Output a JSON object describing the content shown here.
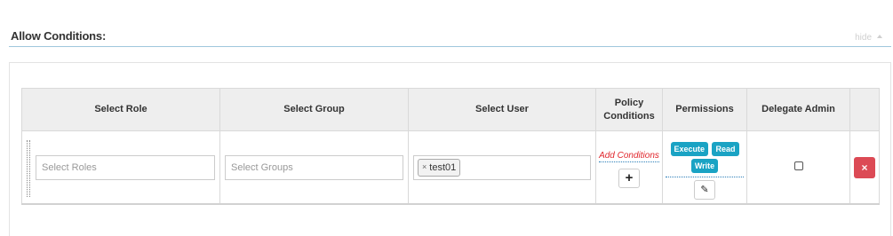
{
  "section": {
    "title": "Allow Conditions:",
    "toggle_label": "hide"
  },
  "table": {
    "headers": {
      "role": "Select Role",
      "group": "Select Group",
      "user": "Select User",
      "policy_line1": "Policy",
      "policy_line2": "Conditions",
      "permissions": "Permissions",
      "delegate": "Delegate Admin"
    },
    "row": {
      "role_placeholder": "Select Roles",
      "group_placeholder": "Select Groups",
      "users": [
        "test01"
      ],
      "add_conditions_label": "Add Conditions",
      "permissions": [
        "Execute",
        "Read",
        "Write"
      ],
      "delegate_admin_checked": false
    }
  },
  "colors": {
    "permission_tag": "#1aa3c4",
    "delete_button": "#dc4a55",
    "add_conditions_text": "#e0262c",
    "header_bg": "#eeeeee",
    "divider": "#9fc7dd"
  },
  "icons": {
    "tag_remove": "×",
    "add": "+",
    "edit": "✎",
    "delete": "×"
  }
}
